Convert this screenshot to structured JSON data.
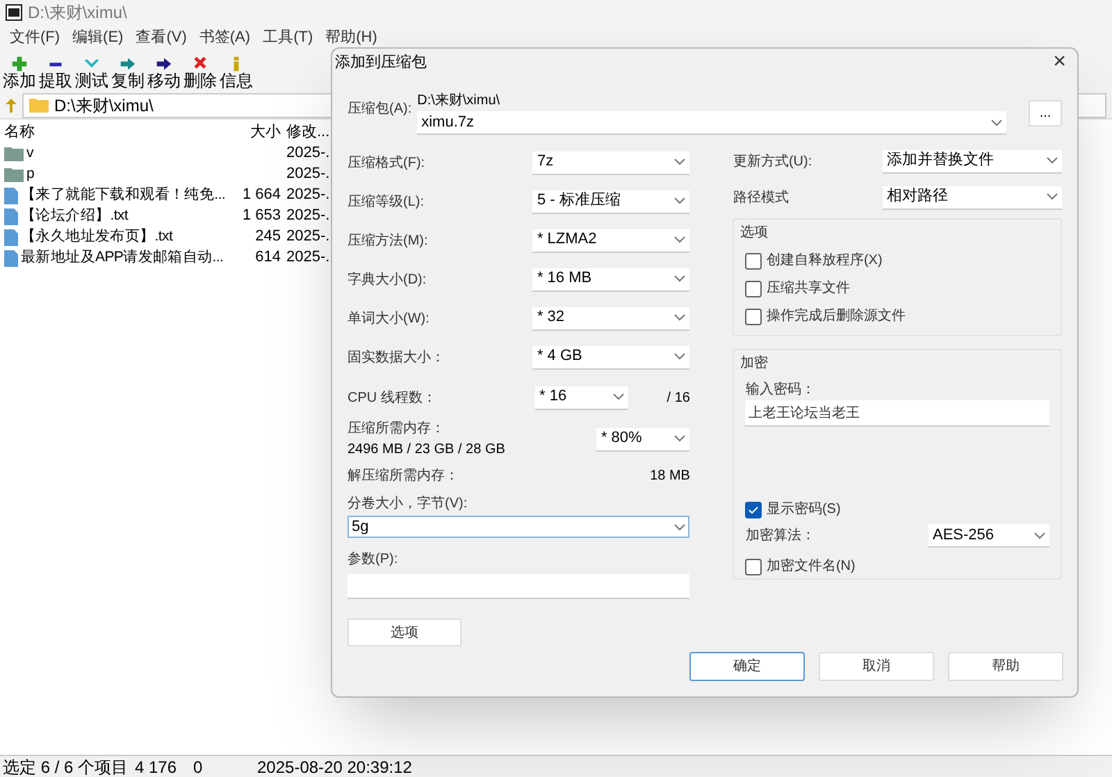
{
  "main": {
    "title": "D:\\来财\\ximu\\",
    "menu": [
      "文件(F)",
      "编辑(E)",
      "查看(V)",
      "书签(A)",
      "工具(T)",
      "帮助(H)"
    ],
    "toolbar": [
      {
        "label": "添加",
        "kind": "add"
      },
      {
        "label": "提取",
        "kind": "extract"
      },
      {
        "label": "测试",
        "kind": "test"
      },
      {
        "label": "复制",
        "kind": "copy"
      },
      {
        "label": "移动",
        "kind": "move"
      },
      {
        "label": "删除",
        "kind": "delete"
      },
      {
        "label": "信息",
        "kind": "info"
      }
    ],
    "address": "D:\\来财\\ximu\\",
    "columns": [
      "名称",
      "大小",
      "修改..."
    ],
    "rows": [
      {
        "kind": "folder",
        "name": "v",
        "size": "",
        "modified": "2025-."
      },
      {
        "kind": "folder",
        "name": "p",
        "size": "",
        "modified": "2025-."
      },
      {
        "kind": "file",
        "name": "【来了就能下载和观看！纯免...",
        "size": "1 664",
        "modified": "2025-."
      },
      {
        "kind": "file",
        "name": "【论坛介绍】.txt",
        "size": "1 653",
        "modified": "2025-."
      },
      {
        "kind": "file",
        "name": "【永久地址发布页】.txt",
        "size": "245",
        "modified": "2025-."
      },
      {
        "kind": "file",
        "name": "最新地址及APP请发邮箱自动...",
        "size": "614",
        "modified": "2025-."
      }
    ],
    "status": [
      "选定 6 / 6 个项目",
      "4 176",
      "0",
      "2025-08-20 20:39:12"
    ]
  },
  "dialog": {
    "title": "添加到压缩包",
    "close": "×",
    "archive_label": "压缩包(A):",
    "archive_dir": "D:\\来财\\ximu\\",
    "archive_name": "ximu.7z",
    "browse": "...",
    "fields": [
      {
        "label": "压缩格式(F):",
        "value": "7z"
      },
      {
        "label": "压缩等级(L):",
        "value": "5 - 标准压缩"
      },
      {
        "label": "压缩方法(M):",
        "value": "*  LZMA2"
      },
      {
        "label": "字典大小(D):",
        "value": "*  16 MB"
      },
      {
        "label": "单词大小(W):",
        "value": "*  32"
      },
      {
        "label": "固实数据大小：",
        "value": "*  4 GB"
      }
    ],
    "cpu": {
      "label": "CPU 线程数：",
      "value": "*  16",
      "max": "/ 16"
    },
    "memory": {
      "label": "压缩所需内存：",
      "value": "2496 MB / 23 GB / 28 GB",
      "percent": "* 80%"
    },
    "decompress": {
      "label": "解压缩所需内存：",
      "value": "18 MB"
    },
    "volume": {
      "label": "分卷大小，字节(V):",
      "value": "5g"
    },
    "params": {
      "label": "参数(P):"
    },
    "options_button": "选项",
    "update": {
      "label": "更新方式(U):",
      "value": "添加并替换文件"
    },
    "path_mode": {
      "label": "路径模式",
      "value": "相对路径"
    },
    "options": {
      "title": "选项",
      "items": [
        {
          "label": "创建自释放程序(X)",
          "checked": false
        },
        {
          "label": "压缩共享文件",
          "checked": false
        },
        {
          "label": "操作完成后删除源文件",
          "checked": false
        }
      ]
    },
    "encryption": {
      "title": "加密",
      "password_label": "输入密码：",
      "password": "上老王论坛当老王",
      "show_password": {
        "label": "显示密码(S)",
        "checked": true
      },
      "method_label": "加密算法：",
      "method": "AES-256",
      "encrypt_names": {
        "label": "加密文件名(N)",
        "checked": false
      }
    },
    "buttons": [
      {
        "label": "确定",
        "default": true
      },
      {
        "label": "取消",
        "default": false
      },
      {
        "label": "帮助",
        "default": false
      }
    ]
  }
}
